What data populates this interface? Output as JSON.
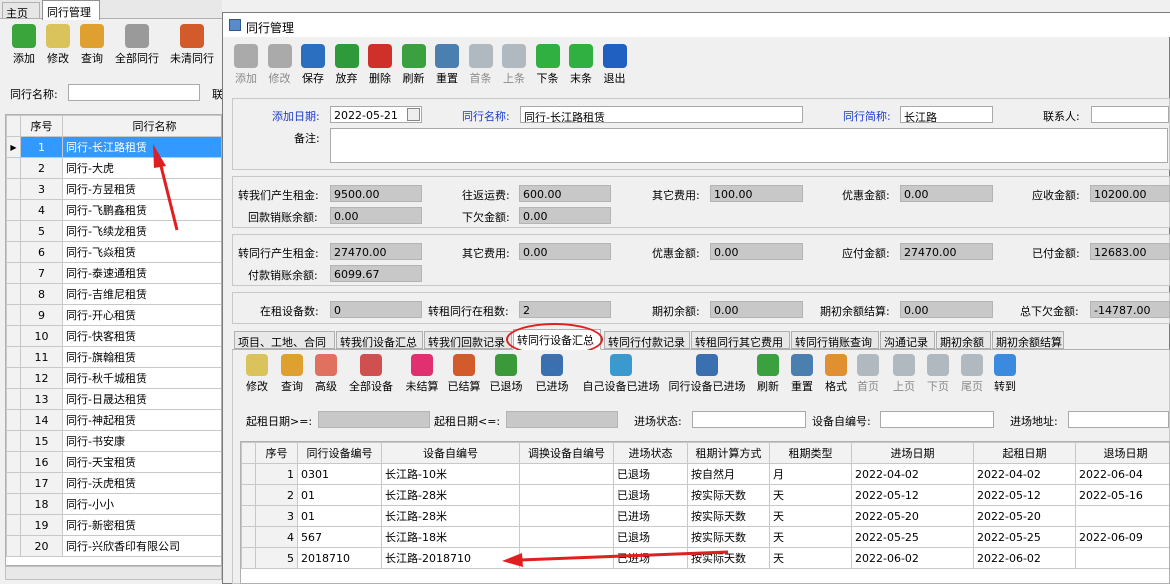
{
  "main_tabs": [
    "主页",
    "同行管理"
  ],
  "left_toolbar": [
    {
      "label": "添加",
      "color": "#3aa53a"
    },
    {
      "label": "修改",
      "color": "#d9c35a"
    },
    {
      "label": "查询",
      "color": "#e0a030"
    },
    {
      "label": "全部同行",
      "color": "#9a9a9a"
    },
    {
      "label": "未清同行",
      "color": "#d35a2a"
    }
  ],
  "left_search": {
    "label": "同行名称:",
    "cut_label": "联"
  },
  "left_table": {
    "headers": [
      "序号",
      "同行名称"
    ],
    "rows": [
      [
        "1",
        "同行-长江路租赁"
      ],
      [
        "2",
        "同行-大虎"
      ],
      [
        "3",
        "同行-方昱租赁"
      ],
      [
        "4",
        "同行-飞鹏鑫租赁"
      ],
      [
        "5",
        "同行-飞续龙租赁"
      ],
      [
        "6",
        "同行-飞焱租赁"
      ],
      [
        "7",
        "同行-泰速通租赁"
      ],
      [
        "8",
        "同行-吉维尼租赁"
      ],
      [
        "9",
        "同行-开心租赁"
      ],
      [
        "10",
        "同行-快客租赁"
      ],
      [
        "11",
        "同行-旗翰租赁"
      ],
      [
        "12",
        "同行-秋千城租赁"
      ],
      [
        "13",
        "同行-日晟达租赁"
      ],
      [
        "14",
        "同行-神起租赁"
      ],
      [
        "15",
        "同行-书安康"
      ],
      [
        "16",
        "同行-天宝租赁"
      ],
      [
        "17",
        "同行-沃虎租赁"
      ],
      [
        "18",
        "同行-小小"
      ],
      [
        "19",
        "同行-新密租赁"
      ],
      [
        "20",
        "同行-兴欣香印有限公司"
      ]
    ]
  },
  "dialog": {
    "title": "同行管理"
  },
  "dialog_toolbar": [
    {
      "label": "添加",
      "enabled": false,
      "color": "#aaaaaa"
    },
    {
      "label": "修改",
      "enabled": false,
      "color": "#aaaaaa"
    },
    {
      "label": "保存",
      "enabled": true,
      "color": "#2a6fc0"
    },
    {
      "label": "放弃",
      "enabled": true,
      "color": "#2e9a3a"
    },
    {
      "label": "删除",
      "enabled": true,
      "color": "#d0302a"
    },
    {
      "label": "刷新",
      "enabled": true,
      "color": "#3aa040"
    },
    {
      "label": "重置",
      "enabled": true,
      "color": "#4a7fb0"
    },
    {
      "label": "首条",
      "enabled": false,
      "color": "#b0b8c0"
    },
    {
      "label": "上条",
      "enabled": false,
      "color": "#b0b8c0"
    },
    {
      "label": "下条",
      "enabled": true,
      "color": "#30b040"
    },
    {
      "label": "末条",
      "enabled": true,
      "color": "#30b040"
    },
    {
      "label": "退出",
      "enabled": true,
      "color": "#2060c0"
    }
  ],
  "info": {
    "add_date_label": "添加日期:",
    "add_date": "2022-05-21",
    "name_label": "同行名称:",
    "name": "同行-长江路租赁",
    "short_label": "同行简称:",
    "short": "长江路",
    "contact_label": "联系人:",
    "note_label": "备注:"
  },
  "summary1": [
    {
      "label": "转我们产生租金:",
      "value": "9500.00"
    },
    {
      "label": "往返运费:",
      "value": "600.00"
    },
    {
      "label": "其它费用:",
      "value": "100.00"
    },
    {
      "label": "优惠金额:",
      "value": "0.00"
    },
    {
      "label": "应收金额:",
      "value": "10200.00"
    },
    {
      "label": "回款销账余额:",
      "value": "0.00"
    },
    {
      "label": "下欠金额:",
      "value": "0.00"
    }
  ],
  "summary2": [
    {
      "label": "转同行产生租金:",
      "value": "27470.00"
    },
    {
      "label": "其它费用:",
      "value": "0.00"
    },
    {
      "label": "优惠金额:",
      "value": "0.00"
    },
    {
      "label": "应付金额:",
      "value": "27470.00"
    },
    {
      "label": "已付金额:",
      "value": "12683.00"
    },
    {
      "label": "付款销账余额:",
      "value": "6099.67"
    }
  ],
  "summary3": [
    {
      "label": "在租设备数:",
      "value": "0"
    },
    {
      "label": "转租同行在租数:",
      "value": "2"
    },
    {
      "label": "期初余额:",
      "value": "0.00"
    },
    {
      "label": "期初余额结算:",
      "value": "0.00"
    },
    {
      "label": "总下欠金额:",
      "value": "-14787.00"
    }
  ],
  "sub_tabs": [
    "项目、工地、合同",
    "转我们设备汇总",
    "转我们回款记录",
    "转同行设备汇总",
    "转同行付款记录",
    "转租同行其它费用",
    "转同行销账查询",
    "沟通记录",
    "期初余额",
    "期初余额结算"
  ],
  "sub_toolbar": [
    {
      "label": "修改",
      "color": "#d9c35a"
    },
    {
      "label": "查询",
      "color": "#e0a030"
    },
    {
      "label": "高级",
      "color": "#e07060"
    },
    {
      "label": "全部设备",
      "color": "#d05050"
    },
    {
      "label": "未结算",
      "color": "#e03070"
    },
    {
      "label": "已结算",
      "color": "#d35a2a"
    },
    {
      "label": "已退场",
      "color": "#3a9a3a"
    },
    {
      "label": "已进场",
      "color": "#3a70b0"
    },
    {
      "label": "自己设备已进场",
      "color": "#3a9ad0"
    },
    {
      "label": "同行设备已进场",
      "color": "#3a70b0"
    },
    {
      "label": "刷新",
      "color": "#3aa040"
    },
    {
      "label": "重置",
      "color": "#4a7fb0"
    },
    {
      "label": "格式",
      "color": "#e09030"
    },
    {
      "label": "首页",
      "color": "#b0b8c0"
    },
    {
      "label": "上页",
      "color": "#b0b8c0"
    },
    {
      "label": "下页",
      "color": "#b0b8c0"
    },
    {
      "label": "尾页",
      "color": "#b0b8c0"
    },
    {
      "label": "转到",
      "color": "#3a8ae0"
    }
  ],
  "filters": {
    "start_from_label": "起租日期>=:",
    "start_to_label": "起租日期<=:",
    "status_label": "进场状态:",
    "device_label": "设备自编号:",
    "address_label": "进场地址:"
  },
  "grid": {
    "headers": [
      "序号",
      "同行设备编号",
      "设备自编号",
      "调换设备自编号",
      "进场状态",
      "租期计算方式",
      "租期类型",
      "进场日期",
      "起租日期",
      "退场日期"
    ],
    "rows": [
      [
        "1",
        "0301",
        "长江路-10米",
        "",
        "已退场",
        "按自然月",
        "月",
        "2022-04-02",
        "2022-04-02",
        "2022-06-04"
      ],
      [
        "2",
        "01",
        "长江路-28米",
        "",
        "已退场",
        "按实际天数",
        "天",
        "2022-05-12",
        "2022-05-12",
        "2022-05-16"
      ],
      [
        "3",
        "01",
        "长江路-28米",
        "",
        "已进场",
        "按实际天数",
        "天",
        "2022-05-20",
        "2022-05-20",
        ""
      ],
      [
        "4",
        "567",
        "长江路-18米",
        "",
        "已退场",
        "按实际天数",
        "天",
        "2022-05-25",
        "2022-05-25",
        "2022-06-09"
      ],
      [
        "5",
        "2018710",
        "长江路-2018710",
        "",
        "已进场",
        "按实际天数",
        "天",
        "2022-06-02",
        "2022-06-02",
        ""
      ]
    ]
  }
}
